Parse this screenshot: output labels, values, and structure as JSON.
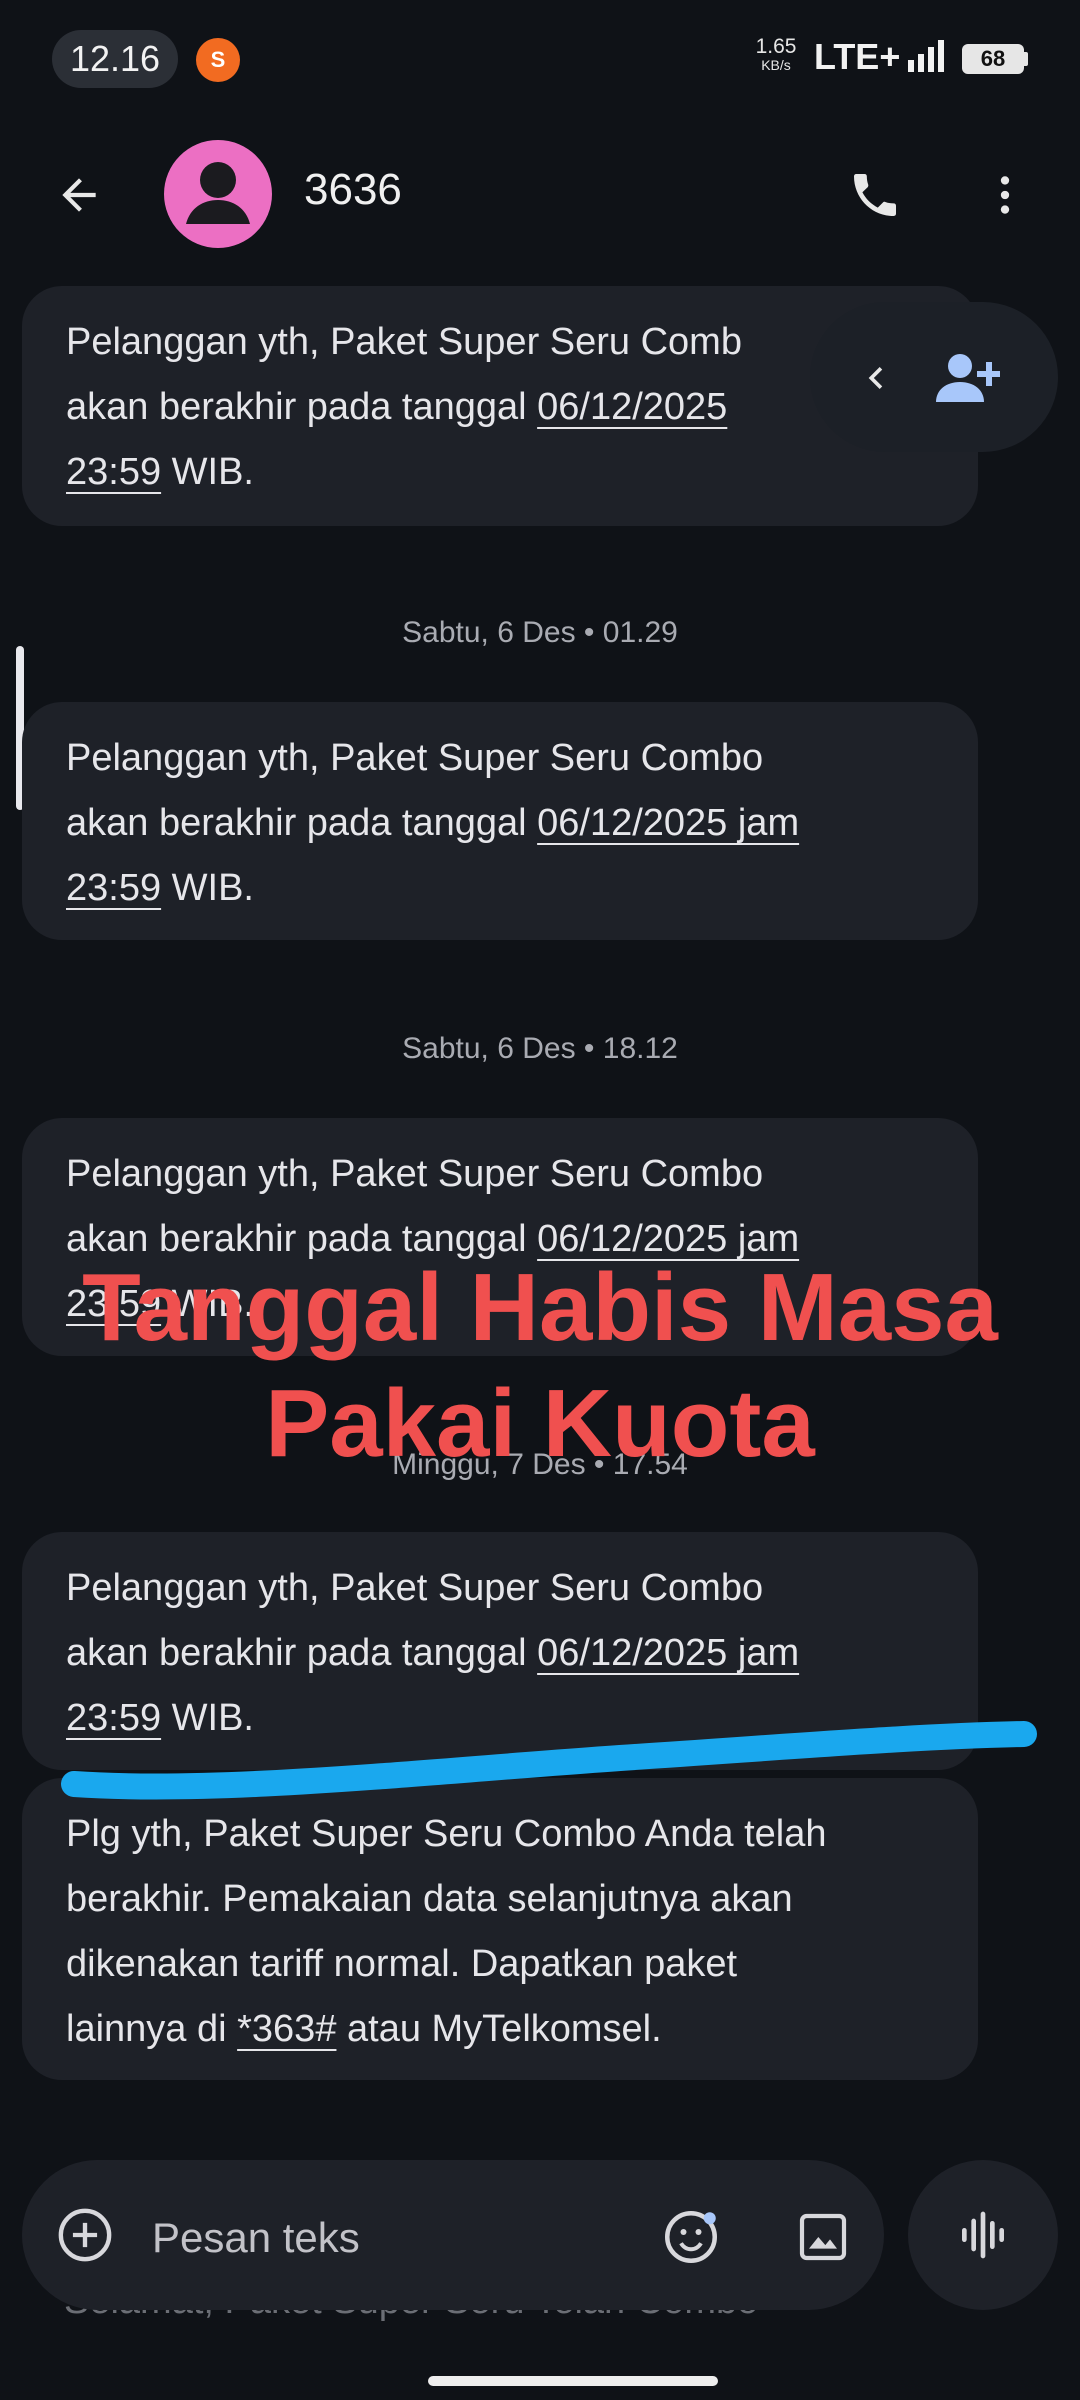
{
  "status_bar": {
    "time": "12.16",
    "shopee_glyph": "S",
    "net_speed_value": "1.65",
    "net_speed_unit": "KB/s",
    "network": "LTE+",
    "battery": "68"
  },
  "header": {
    "contact_name": "3636",
    "icons": [
      "arrow-back-icon",
      "person-icon",
      "phone-icon",
      "more-vert-icon"
    ]
  },
  "messages": [
    {
      "pre": "Pelanggan yth, Paket Super Seru Comb",
      "line2_pre": "akan berakhir pada tanggal ",
      "link1": "06/12/2025",
      "link2": "23:59",
      "post": " WIB."
    },
    {
      "pre": "Pelanggan yth, Paket Super Seru Combo",
      "line2_pre": "akan berakhir pada tanggal ",
      "link1": "06/12/2025 jam",
      "link2": "23:59",
      "post": " WIB."
    },
    {
      "pre": "Pelanggan yth, Paket Super Seru Combo",
      "line2_pre": "akan berakhir pada tanggal ",
      "link1": "06/12/2025 jam",
      "link2": "23:59",
      "post": " WIB."
    },
    {
      "pre": "Pelanggan yth, Paket Super Seru Combo",
      "line2_pre": "akan berakhir pada tanggal ",
      "link1": "06/12/2025 jam",
      "link2": "23:59",
      "post": " WIB."
    }
  ],
  "date_separators": [
    "Sabtu, 6 Des • 01.29",
    "Sabtu, 6 Des • 18.12",
    "Minggu, 7 Des • 17.54"
  ],
  "final_message": {
    "l1": "Plg yth, Paket Super Seru Combo Anda telah",
    "l2": "berakhir. Pemakaian data selanjutnya akan",
    "l3": "dikenakan tariff normal. Dapatkan paket",
    "l4_pre": "lainnya di ",
    "l4_link": "*363#",
    "l4_post": " atau MyTelkomsel."
  },
  "overlay": {
    "line1": "Tanggal Habis Masa",
    "line2": "Pakai Kuota",
    "color": "#f0504f",
    "stroke_color": "#1aa8ee"
  },
  "compose": {
    "placeholder": "Pesan teks",
    "hidden_preview": "Selamat, Paket Super Seru Telah Combo"
  },
  "colors": {
    "background": "#0f1217",
    "bubble": "#1e2128",
    "avatar": "#ec6fc3",
    "accent": "#a8c7fa"
  }
}
